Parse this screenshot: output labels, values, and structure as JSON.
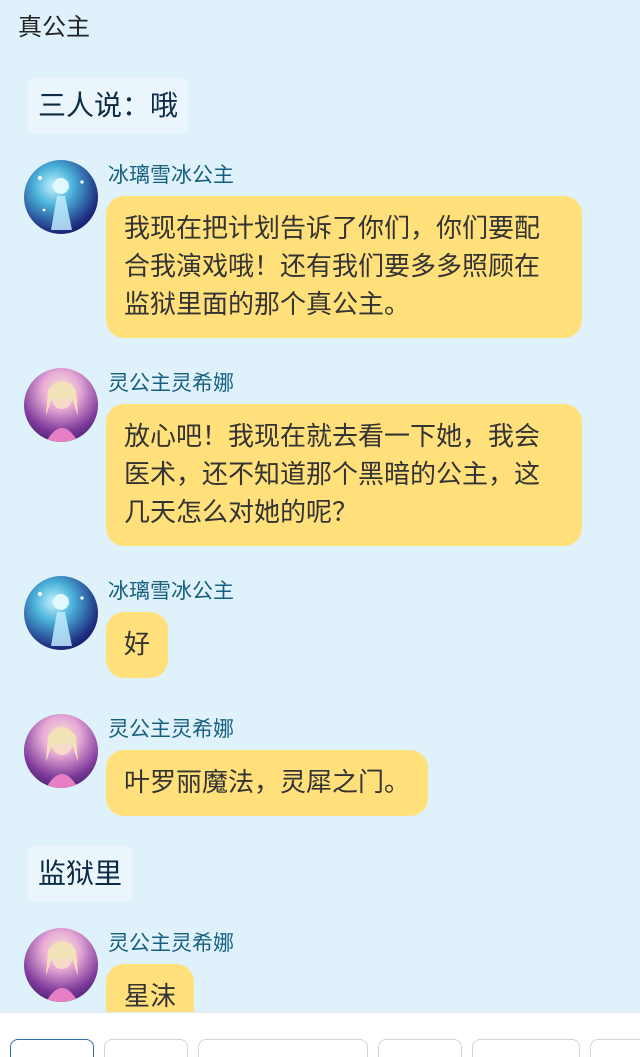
{
  "header": {
    "title": "真公主"
  },
  "narrations": [
    {
      "text": "三人说：哦"
    },
    {
      "text": "监狱里"
    }
  ],
  "messages": [
    {
      "name": "冰璃雪冰公主",
      "avatar": "ice-princess-avatar",
      "text": "我现在把计划告诉了你们，你们要配合我演戏哦！还有我们要多多照顾在监狱里面的那个真公主。"
    },
    {
      "name": "灵公主灵希娜",
      "avatar": "ling-princess-avatar",
      "text": "放心吧！我现在就去看一下她，我会医术，还不知道那个黑暗的公主，这几天怎么对她的呢？"
    },
    {
      "name": "冰璃雪冰公主",
      "avatar": "ice-princess-avatar",
      "text": "好"
    },
    {
      "name": "灵公主灵希娜",
      "avatar": "ling-princess-avatar",
      "text": "叶罗丽魔法，灵犀之门。"
    },
    {
      "name": "灵公主灵希娜",
      "avatar": "ling-princess-avatar",
      "text": "星沫"
    }
  ],
  "colors": {
    "background": "#dff2fb",
    "bubble": "#ffe07a",
    "name": "#16607f"
  }
}
